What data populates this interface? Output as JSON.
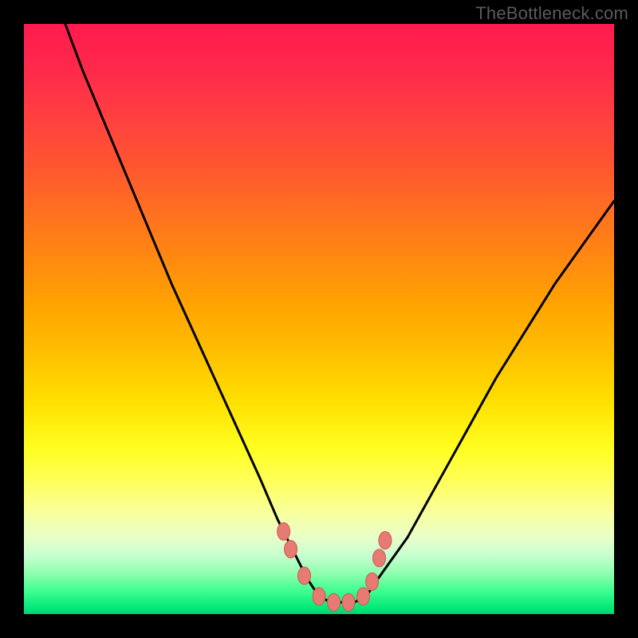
{
  "watermark": "TheBottleneck.com",
  "colors": {
    "background": "#000000",
    "curve": "#000000",
    "marker_fill": "#e77a72",
    "marker_stroke": "#cc5a52",
    "gradient_stops": [
      "#ff1a50",
      "#ff4040",
      "#ff8a10",
      "#ffe000",
      "#ffff60",
      "#c8ffd0",
      "#00e878"
    ]
  },
  "chart_data": {
    "type": "line",
    "title": "",
    "xlabel": "",
    "ylabel": "",
    "xlim": [
      0,
      100
    ],
    "ylim": [
      0,
      100
    ],
    "grid": false,
    "legend": false,
    "series": [
      {
        "name": "bottleneck-curve",
        "x": [
          7,
          10,
          15,
          20,
          25,
          30,
          35,
          40,
          43,
          46,
          48,
          50,
          52,
          54,
          56,
          58,
          60,
          65,
          70,
          75,
          80,
          85,
          90,
          95,
          100
        ],
        "y": [
          100,
          92,
          80,
          68,
          56,
          45,
          34,
          23,
          16,
          10,
          6,
          3,
          2,
          2,
          2,
          3,
          6,
          13,
          22,
          31,
          40,
          48,
          56,
          63,
          70
        ]
      }
    ],
    "markers": {
      "name": "highlight-points",
      "x": [
        44.0,
        45.2,
        47.5,
        50.0,
        52.5,
        55.0,
        57.5,
        59.0,
        60.2,
        61.2
      ],
      "y": [
        14.0,
        11.0,
        6.5,
        3.0,
        2.0,
        2.0,
        3.0,
        5.5,
        9.5,
        12.5
      ]
    }
  }
}
